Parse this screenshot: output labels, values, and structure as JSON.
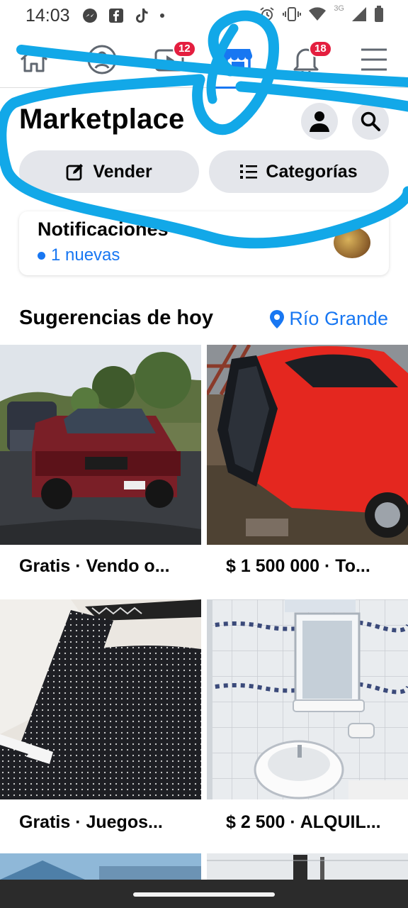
{
  "status_bar": {
    "time": "14:03",
    "network_label": "3G",
    "icons": [
      "messenger-icon",
      "facebook-icon",
      "tiktok-icon",
      "dot-icon",
      "alarm-icon",
      "vibrate-icon",
      "wifi-icon",
      "signal-icon",
      "battery-icon"
    ]
  },
  "nav": {
    "tabs": [
      {
        "name": "home",
        "icon": "home-icon"
      },
      {
        "name": "groups",
        "icon": "groups-icon"
      },
      {
        "name": "watch",
        "icon": "video-icon",
        "badge": "12"
      },
      {
        "name": "marketplace",
        "icon": "shop-icon",
        "active": true
      },
      {
        "name": "notifications",
        "icon": "bell-icon",
        "badge": "18"
      },
      {
        "name": "menu",
        "icon": "menu-icon"
      }
    ]
  },
  "header": {
    "title": "Marketplace",
    "profile_icon": "person-icon",
    "search_icon": "search-icon",
    "sell_label": "Vender",
    "categories_label": "Categorías"
  },
  "notifications_card": {
    "title": "Notificaciones",
    "new_label": "1 nuevas"
  },
  "suggestions": {
    "title": "Sugerencias de hoy",
    "location": "Río Grande",
    "items": [
      {
        "label": "Gratis · Vendo o..."
      },
      {
        "label": "$ 1 500 000 · To..."
      },
      {
        "label": "Gratis · Juegos..."
      },
      {
        "label": "$ 2 500 · ALQUIL..."
      }
    ]
  },
  "colors": {
    "accent": "#1877f2",
    "badge": "#e41e3f",
    "annotation": "#12a8e8"
  }
}
